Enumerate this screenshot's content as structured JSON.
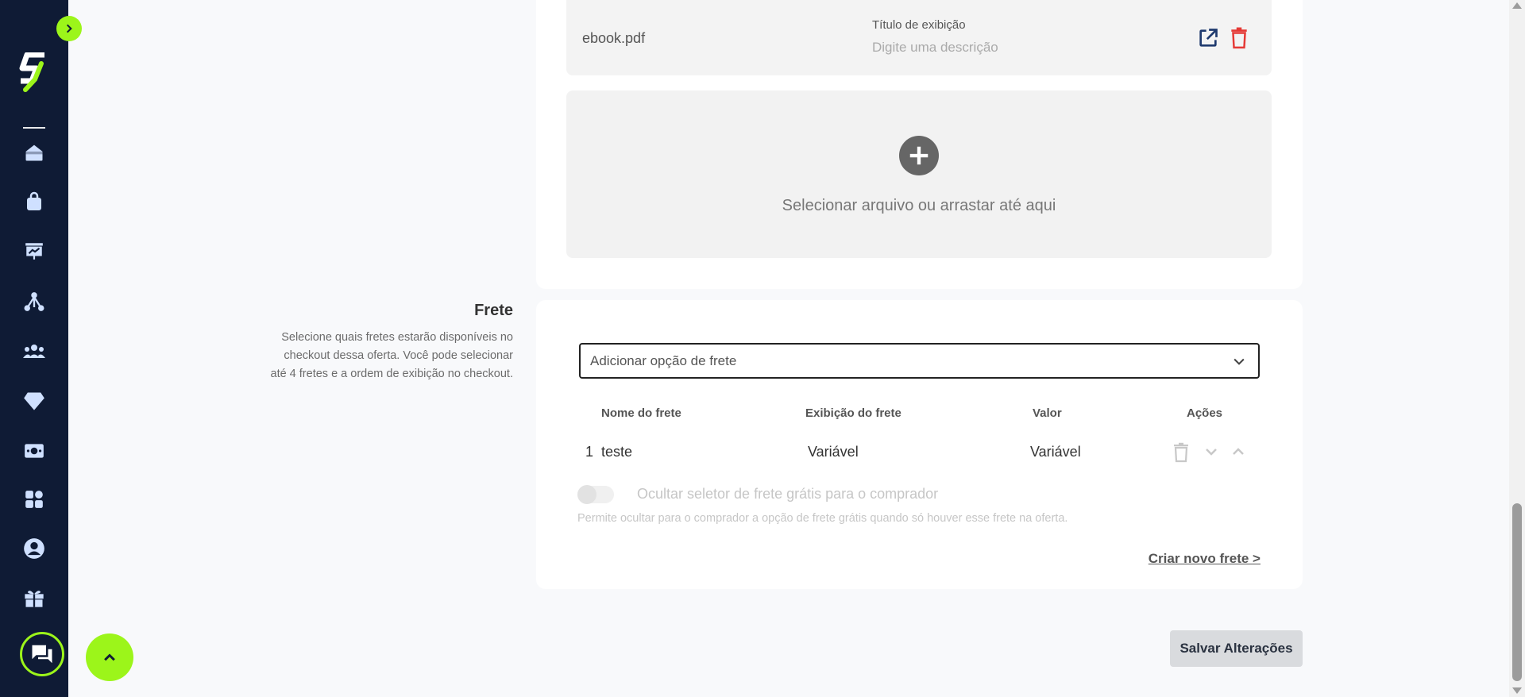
{
  "sidebar": {
    "items": [
      {
        "name": "home-icon"
      },
      {
        "name": "products-bag-icon"
      },
      {
        "name": "presentation-chart-icon"
      },
      {
        "name": "network-icon"
      },
      {
        "name": "users-group-icon"
      },
      {
        "name": "diamond-icon"
      },
      {
        "name": "money-icon"
      },
      {
        "name": "apps-grid-icon"
      },
      {
        "name": "account-circle-icon"
      },
      {
        "name": "gift-icon"
      }
    ],
    "accent": "#9cf51a",
    "background": "#0f1b35"
  },
  "file": {
    "name": "ebook.pdf",
    "display_title_label": "Título de exibição",
    "display_title_placeholder": "Digite uma descrição"
  },
  "dropzone": {
    "text": "Selecionar arquivo ou arrastar até aqui"
  },
  "frete": {
    "title": "Frete",
    "description": "Selecione quais fretes estarão disponíveis no checkout dessa oferta. Você pode selecionar até 4 fretes e a ordem de exibição no checkout.",
    "select_placeholder": "Adicionar opção de frete",
    "columns": {
      "name": "Nome do frete",
      "display": "Exibição do frete",
      "value": "Valor",
      "actions": "Ações"
    },
    "rows": [
      {
        "index": "1",
        "name": "teste",
        "display": "Variável",
        "value": "Variável"
      }
    ],
    "toggle_label": "Ocultar seletor de frete grátis para o comprador",
    "toggle_help": "Permite ocultar para o comprador a opção de frete grátis quando só houver esse frete na oferta.",
    "create_link": "Criar novo frete >"
  },
  "footer": {
    "save_label": "Salvar Alterações"
  },
  "colors": {
    "delete": "#e53935",
    "link_icon": "#1f3a6e"
  }
}
